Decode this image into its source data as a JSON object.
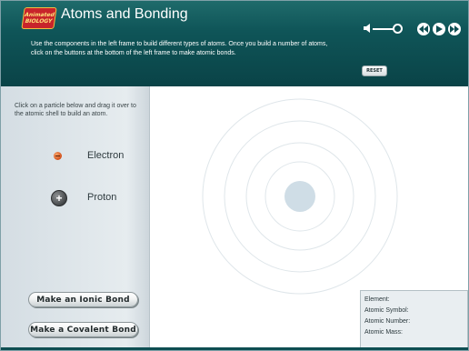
{
  "header": {
    "logo_line1": "Animated",
    "logo_line2": "BIOLOGY",
    "title": "Atoms and Bonding",
    "instructions": "Use the components in the left frame to build different types of atoms. Once you build a number of atoms, click on the buttons at the bottom of the left frame to make atomic bonds.",
    "reset_label": "RESET",
    "icons": {
      "volume": "speaker-icon",
      "back": "rewind-icon",
      "play": "play-icon",
      "forward": "fast-forward-icon"
    }
  },
  "left_panel": {
    "instruction": "Click on a particle below and drag it over to the atomic shell to build an atom.",
    "particles": [
      {
        "label": "Electron",
        "symbol": "-"
      },
      {
        "label": "Proton",
        "symbol": "+"
      }
    ],
    "buttons": {
      "ionic": "Make an Ionic Bond",
      "covalent": "Make a Covalent Bond"
    }
  },
  "info": {
    "element": "Element:",
    "symbol": "Atomic Symbol:",
    "number": "Atomic Number:",
    "mass": "Atomic Mass:"
  },
  "colors": {
    "header_bg": "#0f5558",
    "nucleus": "#cfdde6",
    "shell_stroke": "#dfe6ea",
    "electron": "#e0662a",
    "proton": "#4a4d4f"
  }
}
